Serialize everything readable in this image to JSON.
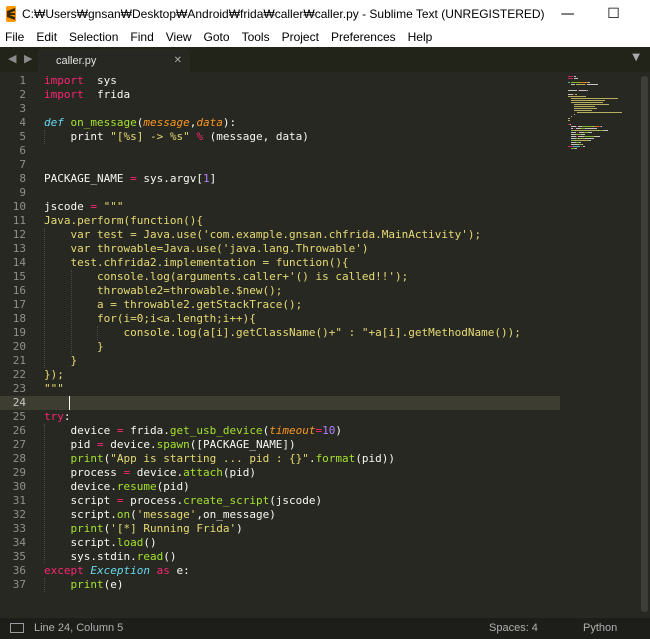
{
  "window": {
    "title": "C:₩Users₩gnsan₩Desktop₩Android₩frida₩caller₩caller.py - Sublime Text (UNREGISTERED)",
    "minimize": "—",
    "maximize": "☐",
    "close": "✕"
  },
  "menu": [
    "File",
    "Edit",
    "Selection",
    "Find",
    "View",
    "Goto",
    "Tools",
    "Project",
    "Preferences",
    "Help"
  ],
  "tabs": {
    "nav": "◀ ▶",
    "active": "caller.py",
    "close": "✕",
    "dropdown": "▼"
  },
  "editor": {
    "current_line": 24,
    "lines": [
      {
        "n": 1,
        "t": [
          [
            "kw",
            "import"
          ],
          [
            "",
            "  sys"
          ]
        ]
      },
      {
        "n": 2,
        "t": [
          [
            "kw",
            "import"
          ],
          [
            "",
            "  frida"
          ]
        ]
      },
      {
        "n": 3,
        "t": []
      },
      {
        "n": 4,
        "t": [
          [
            "ty",
            "def"
          ],
          [
            "",
            " "
          ],
          [
            "fn",
            "on_message"
          ],
          [
            "",
            "("
          ],
          [
            "pa",
            "message"
          ],
          [
            "",
            ","
          ],
          [
            "pa",
            "data"
          ],
          [
            "",
            "):"
          ]
        ]
      },
      {
        "n": 5,
        "t": [
          [
            "",
            "    print "
          ],
          [
            "st",
            "\"[%s] -> %s\""
          ],
          [
            "",
            " "
          ],
          [
            "op",
            "%"
          ],
          [
            "",
            " (message, data)"
          ]
        ]
      },
      {
        "n": 6,
        "t": []
      },
      {
        "n": 7,
        "t": []
      },
      {
        "n": 8,
        "t": [
          [
            "",
            "PACKAGE_NAME "
          ],
          [
            "op",
            "="
          ],
          [
            "",
            " sys.argv["
          ],
          [
            "nu",
            "1"
          ],
          [
            "",
            "]"
          ]
        ]
      },
      {
        "n": 9,
        "t": []
      },
      {
        "n": 10,
        "t": [
          [
            "",
            "jscode "
          ],
          [
            "op",
            "="
          ],
          [
            "",
            " "
          ],
          [
            "st",
            "\"\"\""
          ]
        ]
      },
      {
        "n": 11,
        "t": [
          [
            "st",
            "Java.perform(function(){"
          ]
        ]
      },
      {
        "n": 12,
        "t": [
          [
            "st",
            "    var test = Java.use('com.example.gnsan.chfrida.MainActivity');"
          ]
        ]
      },
      {
        "n": 13,
        "t": [
          [
            "st",
            "    var throwable=Java.use('java.lang.Throwable')"
          ]
        ]
      },
      {
        "n": 14,
        "t": [
          [
            "st",
            "    test.chfrida2.implementation = function(){"
          ]
        ]
      },
      {
        "n": 15,
        "t": [
          [
            "st",
            "        console.log(arguments.caller+'() is called!!');"
          ]
        ]
      },
      {
        "n": 16,
        "t": [
          [
            "st",
            "        throwable2=throwable.$new();"
          ]
        ]
      },
      {
        "n": 17,
        "t": [
          [
            "st",
            "        a = throwable2.getStackTrace();"
          ]
        ]
      },
      {
        "n": 18,
        "t": [
          [
            "st",
            "        for(i=0;i<a.length;i++){"
          ]
        ]
      },
      {
        "n": 19,
        "t": [
          [
            "st",
            "            console.log(a[i].getClassName()+\" : \"+a[i].getMethodName());"
          ]
        ]
      },
      {
        "n": 20,
        "t": [
          [
            "st",
            "        }"
          ]
        ]
      },
      {
        "n": 21,
        "t": [
          [
            "st",
            "    }"
          ]
        ]
      },
      {
        "n": 22,
        "t": [
          [
            "st",
            "});"
          ]
        ]
      },
      {
        "n": 23,
        "t": [
          [
            "st",
            "\"\"\""
          ]
        ]
      },
      {
        "n": 24,
        "t": []
      },
      {
        "n": 25,
        "t": [
          [
            "kw",
            "try"
          ],
          [
            "",
            ":"
          ]
        ]
      },
      {
        "n": 26,
        "t": [
          [
            "",
            "    device "
          ],
          [
            "op",
            "="
          ],
          [
            "",
            " frida."
          ],
          [
            "fn",
            "get_usb_device"
          ],
          [
            "",
            "("
          ],
          [
            "pa",
            "timeout"
          ],
          [
            "op",
            "="
          ],
          [
            "nu",
            "10"
          ],
          [
            "",
            ")"
          ]
        ]
      },
      {
        "n": 27,
        "t": [
          [
            "",
            "    pid "
          ],
          [
            "op",
            "="
          ],
          [
            "",
            " device."
          ],
          [
            "fn",
            "spawn"
          ],
          [
            "",
            "([PACKAGE_NAME])"
          ]
        ]
      },
      {
        "n": 28,
        "t": [
          [
            "",
            "    "
          ],
          [
            "fn",
            "print"
          ],
          [
            "",
            "("
          ],
          [
            "st",
            "\"App is starting ... pid : {}\""
          ],
          [
            "",
            "."
          ],
          [
            "fn",
            "format"
          ],
          [
            "",
            "(pid))"
          ]
        ]
      },
      {
        "n": 29,
        "t": [
          [
            "",
            "    process "
          ],
          [
            "op",
            "="
          ],
          [
            "",
            " device."
          ],
          [
            "fn",
            "attach"
          ],
          [
            "",
            "(pid)"
          ]
        ]
      },
      {
        "n": 30,
        "t": [
          [
            "",
            "    device."
          ],
          [
            "fn",
            "resume"
          ],
          [
            "",
            "(pid)"
          ]
        ]
      },
      {
        "n": 31,
        "t": [
          [
            "",
            "    script "
          ],
          [
            "op",
            "="
          ],
          [
            "",
            " process."
          ],
          [
            "fn",
            "create_script"
          ],
          [
            "",
            "(jscode)"
          ]
        ]
      },
      {
        "n": 32,
        "t": [
          [
            "",
            "    script."
          ],
          [
            "fn",
            "on"
          ],
          [
            "",
            "("
          ],
          [
            "st",
            "'message'"
          ],
          [
            "",
            ",on_message)"
          ]
        ]
      },
      {
        "n": 33,
        "t": [
          [
            "",
            "    "
          ],
          [
            "fn",
            "print"
          ],
          [
            "",
            "("
          ],
          [
            "st",
            "'[*] Running Frida'"
          ],
          [
            "",
            ")"
          ]
        ]
      },
      {
        "n": 34,
        "t": [
          [
            "",
            "    script."
          ],
          [
            "fn",
            "load"
          ],
          [
            "",
            "()"
          ]
        ]
      },
      {
        "n": 35,
        "t": [
          [
            "",
            "    sys.stdin."
          ],
          [
            "fn",
            "read"
          ],
          [
            "",
            "()"
          ]
        ]
      },
      {
        "n": 36,
        "t": [
          [
            "kw",
            "except"
          ],
          [
            "",
            " "
          ],
          [
            "ex",
            "Exception"
          ],
          [
            "",
            " "
          ],
          [
            "kw",
            "as"
          ],
          [
            "",
            " e:"
          ]
        ]
      },
      {
        "n": 37,
        "t": [
          [
            "",
            "    "
          ],
          [
            "fn",
            "print"
          ],
          [
            "",
            "(e)"
          ]
        ]
      }
    ]
  },
  "status": {
    "position": "Line 24, Column 5",
    "spaces": "Spaces: 4",
    "syntax": "Python"
  },
  "colors": {
    "background": "#272822",
    "keyword": "#f92672",
    "function": "#a6e22e",
    "string": "#e6db74",
    "number": "#ae81ff",
    "param": "#fd971f",
    "type": "#66d9ef"
  }
}
